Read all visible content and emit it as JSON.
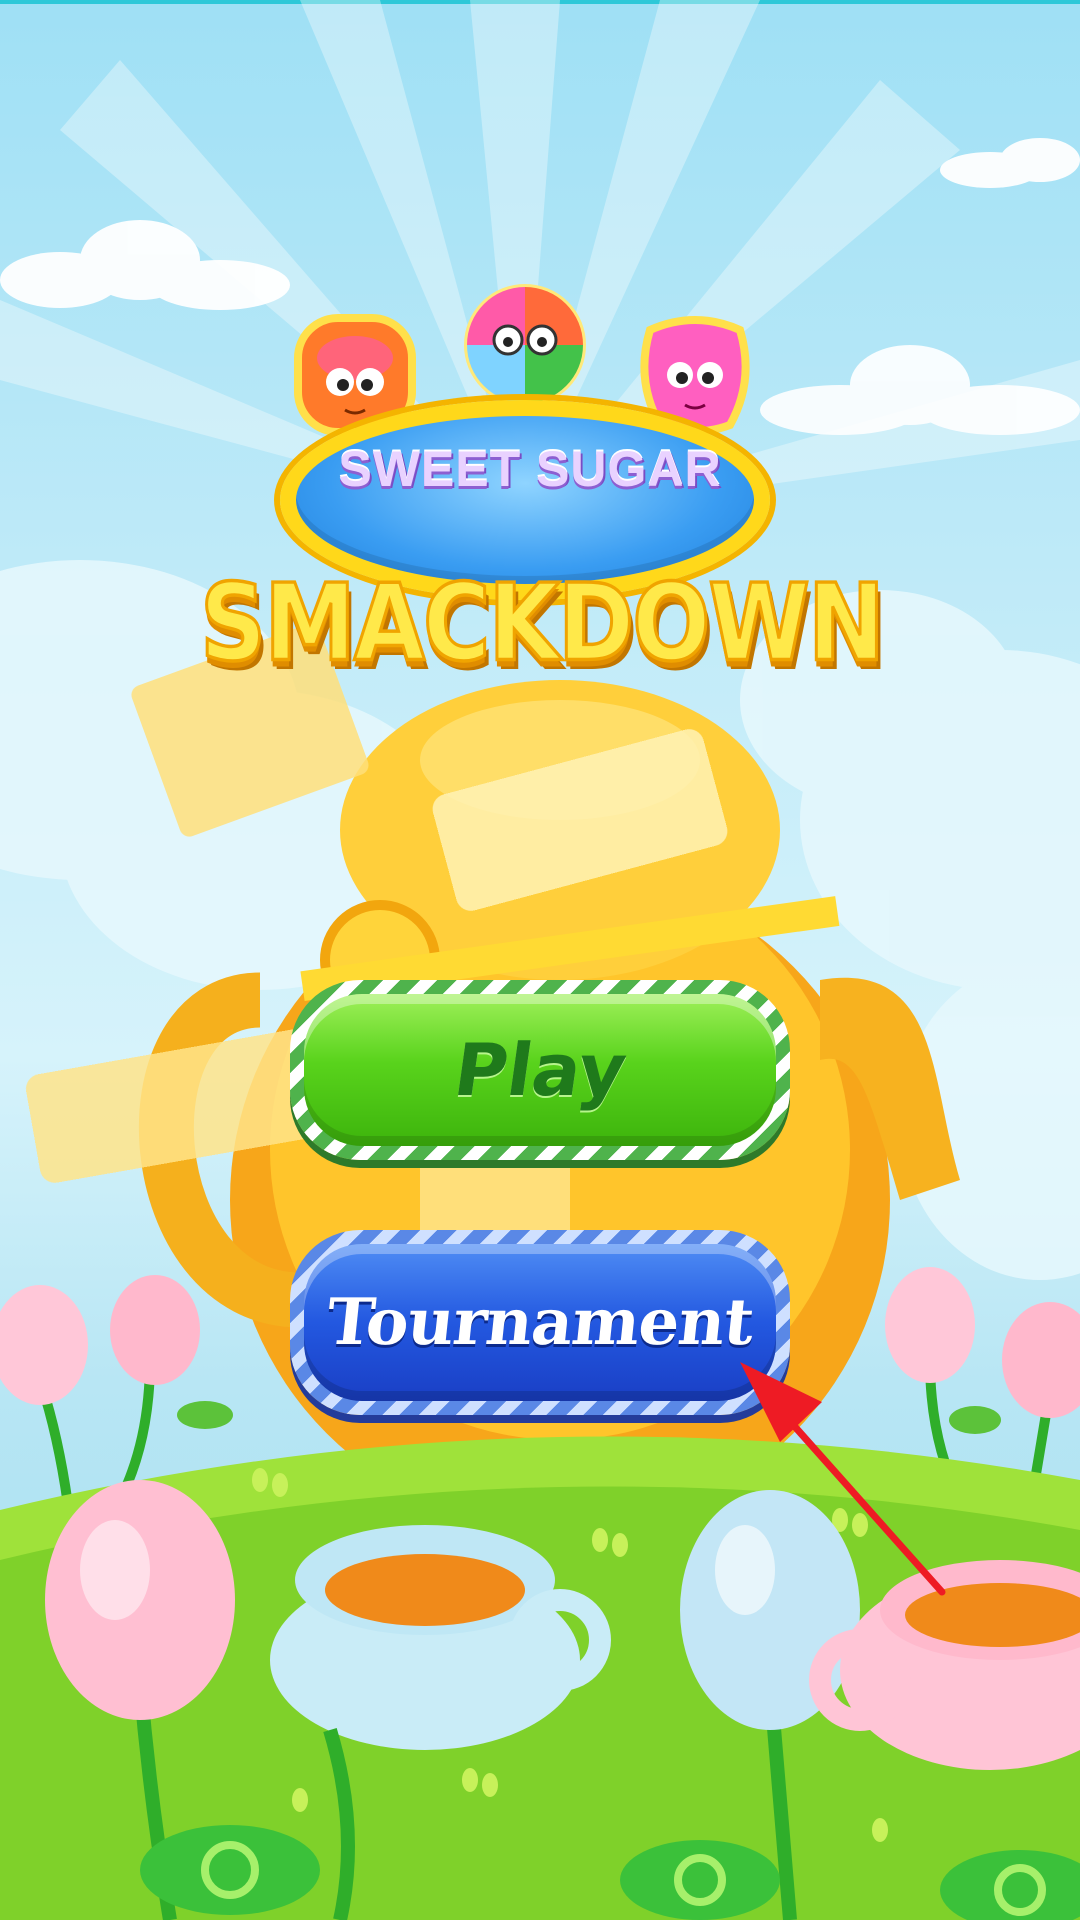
{
  "game": {
    "title_line1": "SWEET SUGAR",
    "title_line2": "SMACKDOWN"
  },
  "menu": {
    "play_label": "Play",
    "tournament_label": "Tournament"
  },
  "colors": {
    "sky": "#bfeaf8",
    "play_green": "#59d31c",
    "tournament_blue": "#2358e0",
    "title_yellow": "#ffe94a",
    "annotation_arrow": "#ee1b24"
  },
  "icons": [
    "orange-candy-icon",
    "striped-candy-icon",
    "pink-candy-icon",
    "annotation-arrow-icon"
  ]
}
